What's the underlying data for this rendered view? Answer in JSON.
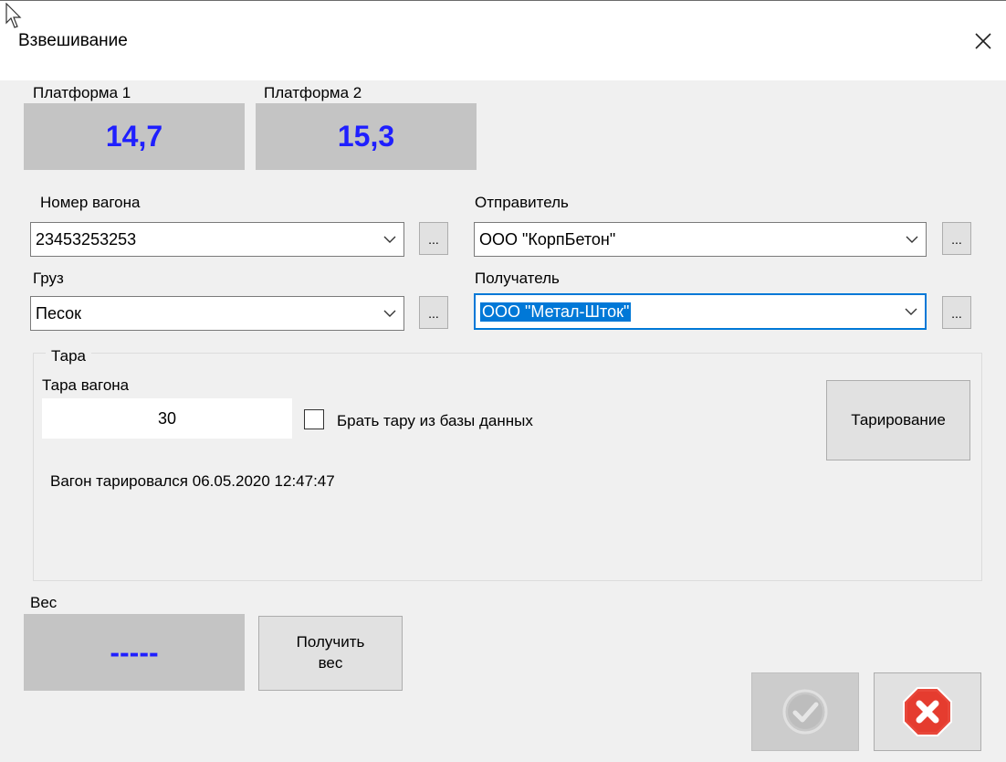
{
  "window": {
    "title": "Взвешивание",
    "close_glyph": "✕"
  },
  "platforms": [
    {
      "label": "Платформа 1",
      "value": "14,7"
    },
    {
      "label": "Платформа 2",
      "value": "15,3"
    }
  ],
  "fields": {
    "wagon_number": {
      "label": "Номер вагона",
      "value": "23453253253",
      "browse_label": "..."
    },
    "sender": {
      "label": "Отправитель",
      "value": "ООО \"КорпБетон\"",
      "browse_label": "..."
    },
    "cargo": {
      "label": "Груз",
      "value": "Песок",
      "browse_label": "..."
    },
    "receiver": {
      "label": "Получатель",
      "value": "ООО \"Метал-Шток\"",
      "browse_label": "..."
    }
  },
  "tare": {
    "group_title": "Тара",
    "wagon_tare_label": "Тара вагона",
    "wagon_tare_value": "30",
    "use_db_label": "Брать тару из базы данных",
    "use_db_checked": false,
    "taring_button": "Тарирование",
    "last_taring_text": "Вагон тарировался 06.05.2020 12:47:47"
  },
  "weight": {
    "label": "Вес",
    "value": "-----",
    "get_weight_line1": "Получить",
    "get_weight_line2": "вес"
  },
  "colors": {
    "display_value": "#1f1fff",
    "display_bg": "#c4c4c4",
    "focus_accent": "#0078d7",
    "cancel_red": "#e8473a",
    "ok_disabled": "#c0c0c0"
  }
}
